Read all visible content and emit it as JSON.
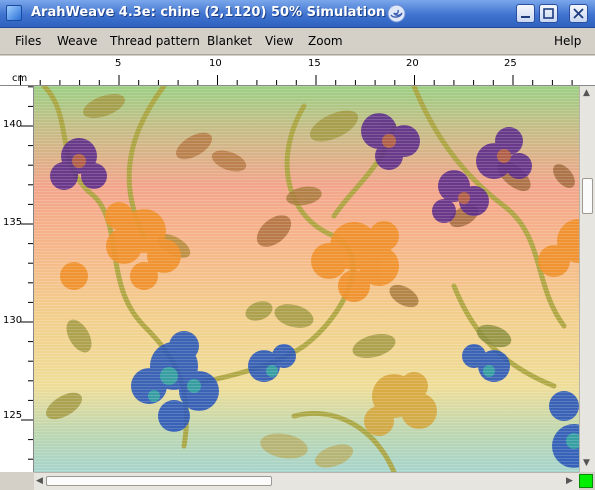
{
  "window": {
    "title": "ArahWeave 4.3e: chine (2,1120) 50% Simulation 7",
    "title_color": "#ffffff",
    "titlebar_color": "#3f73cf"
  },
  "menubar": {
    "items": [
      "Files",
      "Weave",
      "Thread pattern",
      "Blanket",
      "View",
      "Zoom"
    ],
    "help": "Help"
  },
  "ruler": {
    "unit": "cm",
    "top_ticks": [
      "5",
      "10",
      "15",
      "20",
      "25"
    ],
    "left_ticks": [
      "140",
      "135",
      "130",
      "125"
    ]
  },
  "canvas": {
    "content": "chine fabric simulation",
    "palette": {
      "band_top": "#9ccf83",
      "band_mid": "#f2a58a",
      "band_warm": "#f0d289",
      "band_bottom": "#a6d4cc",
      "flower_purple": "#5a2a8a",
      "flower_orange": "#f0902a",
      "flower_blue": "#2a57b8",
      "leaf_olive": "#9a9a3a"
    }
  },
  "status": {
    "indicator_color": "#00ee00"
  }
}
